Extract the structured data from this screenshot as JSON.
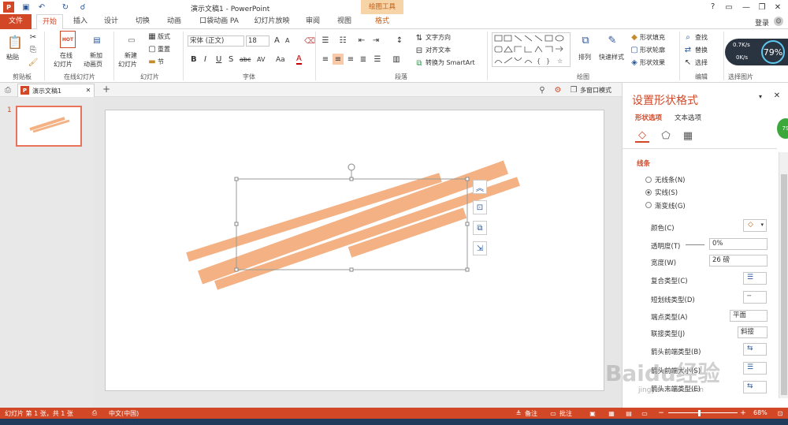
{
  "app": {
    "title": "演示文稿1 - PowerPoint",
    "context_tab_group": "绘图工具",
    "help": "?",
    "login": "登录"
  },
  "tabs": [
    "文件",
    "开始",
    "插入",
    "设计",
    "切换",
    "动画",
    "口袋动画 PA",
    "幻灯片放映",
    "审阅",
    "视图",
    "格式"
  ],
  "ribbon": {
    "clipboard": {
      "paste": "粘贴",
      "group": "剪贴板"
    },
    "online": {
      "online_slide_1": "在线",
      "online_slide_2": "幻灯片",
      "new_anim_1": "新加",
      "new_anim_2": "动画页",
      "hot": "HOT",
      "group": "在线幻灯片"
    },
    "slides": {
      "new_slide_1": "新建",
      "new_slide_2": "幻灯片",
      "layout": "版式",
      "reset": "重置",
      "section": "节",
      "group": "幻灯片"
    },
    "font": {
      "font_name": "宋体 (正文)",
      "font_size": "18",
      "group": "字体",
      "grow": "A",
      "shrink": "A",
      "bold": "B",
      "italic": "I",
      "underline": "U",
      "shadow": "S",
      "strike": "abc",
      "spacing": "AV",
      "case": "Aa",
      "color": "A"
    },
    "paragraph": {
      "text_direction": "文字方向",
      "align_text": "对齐文本",
      "smartart": "转换为 SmartArt",
      "group": "段落"
    },
    "drawing": {
      "arrange": "排列",
      "quick_styles": "快速样式",
      "shape_fill": "形状填充",
      "shape_outline": "形状轮廓",
      "shape_effect": "形状效果",
      "group": "绘图"
    },
    "editing": {
      "find": "查找",
      "replace": "替换",
      "select": "选择",
      "group": "编辑"
    },
    "pictures": {
      "group": "选择图片"
    },
    "net_meter": {
      "up": "0.7K/s",
      "down": "0K/s",
      "percent": "79%"
    }
  },
  "doc_tab": {
    "name": "演示文稿1",
    "add": "+",
    "multi_window": "多窗口模式"
  },
  "thumbnail": {
    "number": "1"
  },
  "pane": {
    "title": "设置形状格式",
    "tab_shape": "形状选项",
    "tab_text": "文本选项",
    "section": "线条",
    "no_line": "无线条(N)",
    "solid_line": "实线(S)",
    "gradient_line": "渐变线(G)",
    "color": "颜色(C)",
    "transparency": "透明度(T)",
    "transparency_value": "0%",
    "width": "宽度(W)",
    "width_value": "26 磅",
    "compound": "复合类型(C)",
    "dash": "短划线类型(D)",
    "cap": "端点类型(A)",
    "cap_value": "平面",
    "join": "联接类型(J)",
    "join_value": "斜接",
    "arrow_begin": "箭头前端类型(B)",
    "arrow_begin_size": "箭头前端大小(S)",
    "arrow_end": "箭头末端类型(E)",
    "badge": "79"
  },
  "status": {
    "slide_info": "幻灯片 第 1 张，共 1 张",
    "language": "中文(中国)",
    "notes": "备注",
    "comments": "批注",
    "zoom": "68%"
  },
  "watermark": {
    "logo": "Baidu经验",
    "url": "jingyan.baidu.com"
  },
  "colors": {
    "accent": "#d24726",
    "shape": "#f4b183",
    "tab_active": "#d24726",
    "context": "#f0a030"
  }
}
